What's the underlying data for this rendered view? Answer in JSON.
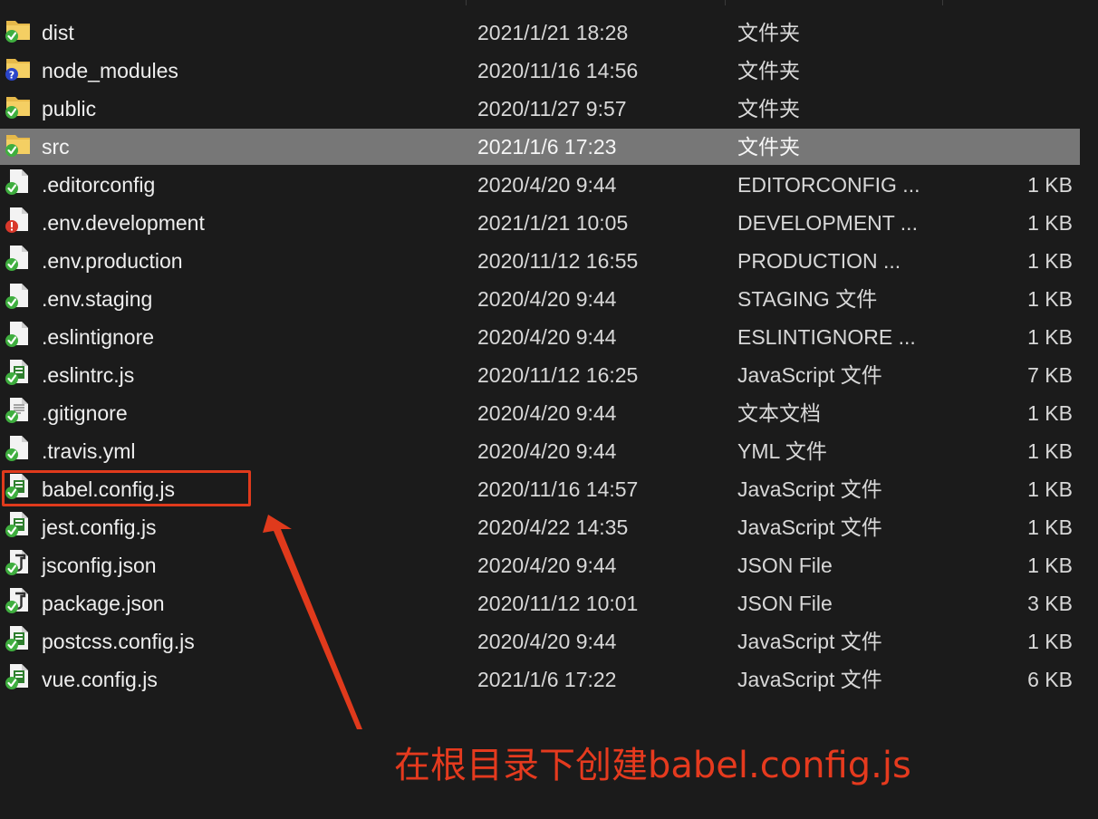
{
  "files": [
    {
      "name": "dist",
      "date": "2021/1/21 18:28",
      "type": "文件夹",
      "size": "",
      "icon": "folder-synced-icon",
      "selected": false
    },
    {
      "name": "node_modules",
      "date": "2020/11/16 14:56",
      "type": "文件夹",
      "size": "",
      "icon": "folder-unversioned-icon",
      "selected": false
    },
    {
      "name": "public",
      "date": "2020/11/27 9:57",
      "type": "文件夹",
      "size": "",
      "icon": "folder-synced-icon",
      "selected": false
    },
    {
      "name": "src",
      "date": "2021/1/6 17:23",
      "type": "文件夹",
      "size": "",
      "icon": "folder-synced-icon",
      "selected": true
    },
    {
      "name": ".editorconfig",
      "date": "2020/4/20 9:44",
      "type": "EDITORCONFIG ...",
      "size": "1 KB",
      "icon": "file-synced-icon",
      "selected": false
    },
    {
      "name": ".env.development",
      "date": "2021/1/21 10:05",
      "type": "DEVELOPMENT ...",
      "size": "1 KB",
      "icon": "file-modified-icon",
      "selected": false
    },
    {
      "name": ".env.production",
      "date": "2020/11/12 16:55",
      "type": "PRODUCTION ...",
      "size": "1 KB",
      "icon": "file-synced-icon",
      "selected": false
    },
    {
      "name": ".env.staging",
      "date": "2020/4/20 9:44",
      "type": "STAGING 文件",
      "size": "1 KB",
      "icon": "file-synced-icon",
      "selected": false
    },
    {
      "name": ".eslintignore",
      "date": "2020/4/20 9:44",
      "type": "ESLINTIGNORE ...",
      "size": "1 KB",
      "icon": "file-synced-icon",
      "selected": false
    },
    {
      "name": ".eslintrc.js",
      "date": "2020/11/12 16:25",
      "type": "JavaScript 文件",
      "size": "7 KB",
      "icon": "js-file-synced-icon",
      "selected": false
    },
    {
      "name": ".gitignore",
      "date": "2020/4/20 9:44",
      "type": "文本文档",
      "size": "1 KB",
      "icon": "text-file-synced-icon",
      "selected": false
    },
    {
      "name": ".travis.yml",
      "date": "2020/4/20 9:44",
      "type": "YML 文件",
      "size": "1 KB",
      "icon": "file-synced-icon",
      "selected": false
    },
    {
      "name": "babel.config.js",
      "date": "2020/11/16 14:57",
      "type": "JavaScript 文件",
      "size": "1 KB",
      "icon": "js-file-synced-icon",
      "selected": false
    },
    {
      "name": "jest.config.js",
      "date": "2020/4/22 14:35",
      "type": "JavaScript 文件",
      "size": "1 KB",
      "icon": "js-file-synced-icon",
      "selected": false
    },
    {
      "name": "jsconfig.json",
      "date": "2020/4/20 9:44",
      "type": "JSON File",
      "size": "1 KB",
      "icon": "json-file-synced-icon",
      "selected": false
    },
    {
      "name": "package.json",
      "date": "2020/11/12 10:01",
      "type": "JSON File",
      "size": "3 KB",
      "icon": "json-file-synced-icon",
      "selected": false
    },
    {
      "name": "postcss.config.js",
      "date": "2020/4/20 9:44",
      "type": "JavaScript 文件",
      "size": "1 KB",
      "icon": "js-file-synced-icon",
      "selected": false
    },
    {
      "name": "vue.config.js",
      "date": "2021/1/6 17:22",
      "type": "JavaScript 文件",
      "size": "6 KB",
      "icon": "js-file-synced-icon",
      "selected": false
    }
  ],
  "annotation": {
    "text": "在根目录下创建babel.config.js",
    "color": "#e53a1e"
  },
  "colors": {
    "background": "#1b1b1b",
    "selection": "#777777",
    "highlight": "#e03a1c",
    "sync_green": "#3fae3f"
  }
}
